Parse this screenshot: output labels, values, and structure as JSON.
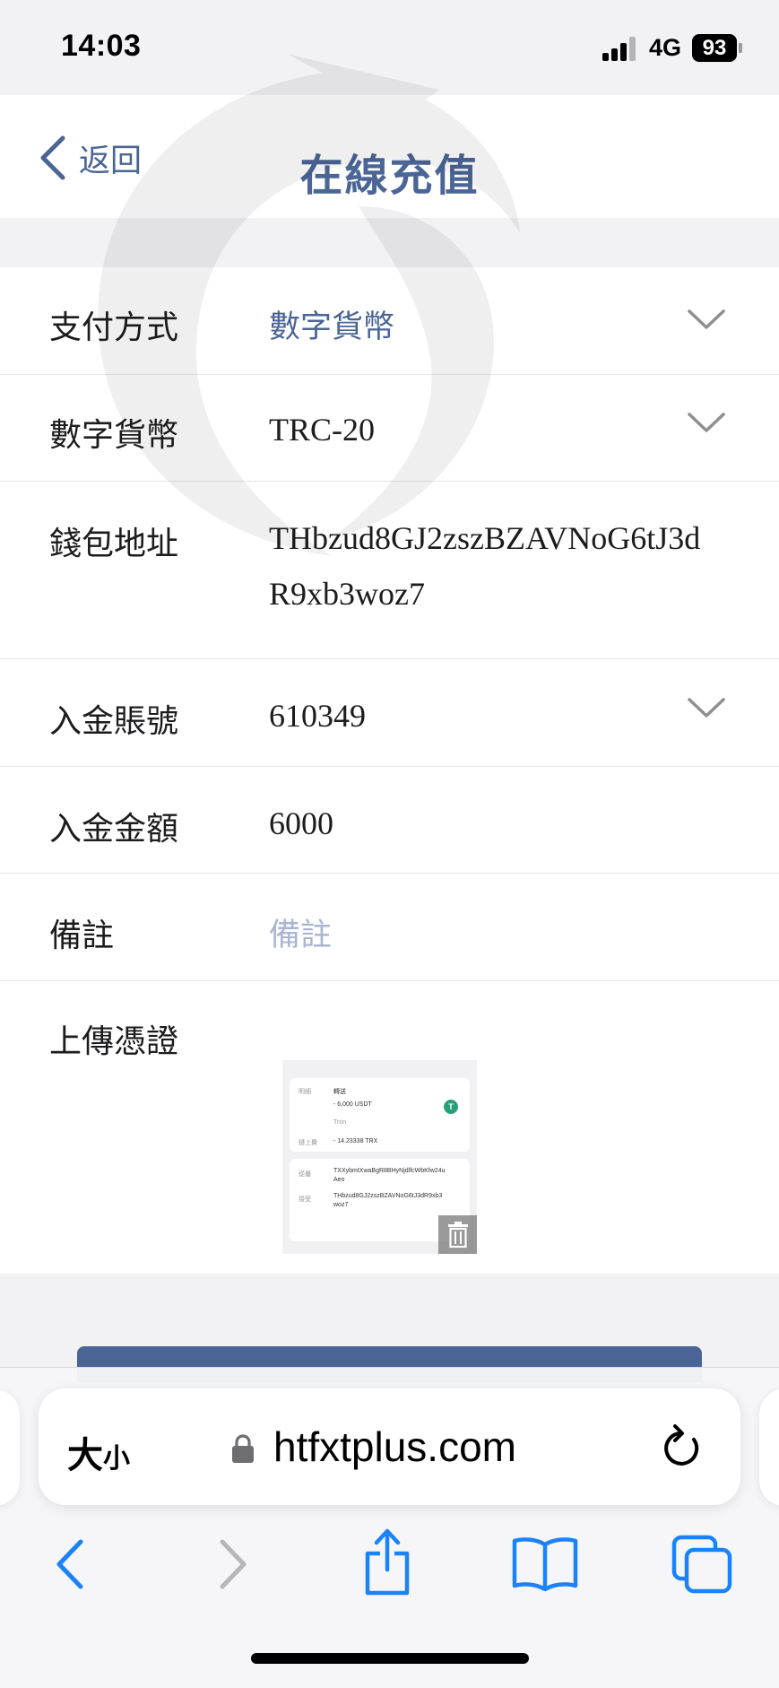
{
  "status_bar": {
    "time": "14:03",
    "network": "4G",
    "battery": "93"
  },
  "header": {
    "back_label": "返回",
    "title": "在線充值"
  },
  "form": {
    "payment_method": {
      "label": "支付方式",
      "value": "數字貨幣"
    },
    "currency": {
      "label": "數字貨幣",
      "value": "TRC-20"
    },
    "wallet_address": {
      "label": "錢包地址",
      "line1": "THbzud8GJ2zszBZAVNoG6tJ3d",
      "line2": "R9xb3woz7"
    },
    "deposit_account": {
      "label": "入金賬號",
      "value": "610349"
    },
    "deposit_amount": {
      "label": "入金金額",
      "value": "6000"
    },
    "remark": {
      "label": "備註",
      "placeholder": "備註"
    },
    "upload_proof": {
      "label": "上傳憑證"
    }
  },
  "receipt_thumbnail": {
    "details_label": "明細",
    "transfer_label": "轉送",
    "amount": "- 6,000 USDT",
    "network": "Tron",
    "fee_label": "鏈上費",
    "fee": "- 14.23338 TRX",
    "from_label": "從屬",
    "from_address_1": "TXXybmtXwaBgR8BHyNjdlfcWbKfw24u",
    "from_address_2": "Aeo",
    "to_label": "接受",
    "to_address_1": "THbzud8GJ2zszBZAVNoG6tJ3dR9xb3",
    "to_address_2": "woz7",
    "tether_symbol": "T"
  },
  "browser": {
    "text_size_big": "大",
    "text_size_small": "小",
    "url": "htfxtplus.com"
  },
  "colors": {
    "accent": "#4a6596",
    "placeholder": "#aab6cf",
    "background": "#f2f2f4",
    "ios_blue": "#1a82fb",
    "tether_green": "#26a17b"
  },
  "icons": [
    "back-chevron-icon",
    "chevron-down-icon",
    "trash-icon",
    "lock-icon",
    "reload-icon",
    "back-arrow-icon",
    "forward-arrow-icon",
    "share-icon",
    "bookmarks-icon",
    "tabs-icon"
  ]
}
